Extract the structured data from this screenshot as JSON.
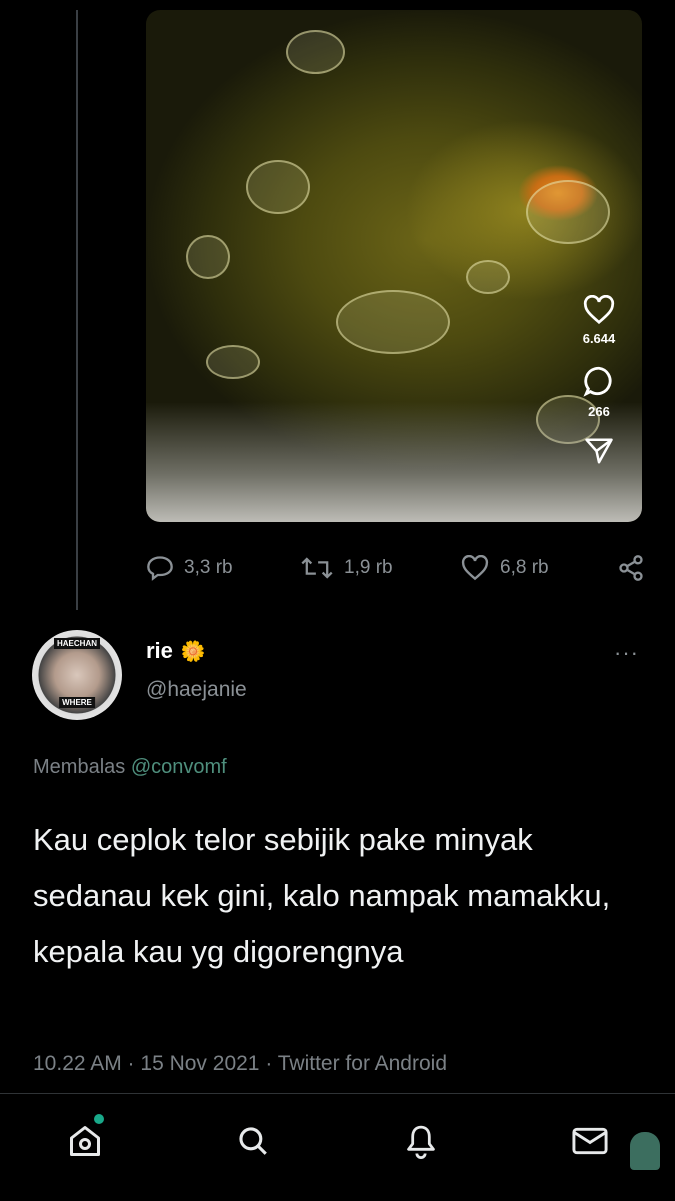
{
  "media": {
    "likes": "6.644",
    "comments": "266",
    "icons": [
      "heart-icon",
      "comment-icon",
      "send-icon"
    ]
  },
  "actions": {
    "replies": "3,3 rb",
    "retweets": "1,9 rb",
    "likes": "6,8 rb",
    "icons": [
      "reply-icon",
      "retweet-icon",
      "like-icon",
      "share-icon"
    ]
  },
  "reply": {
    "avatar_tag_top": "HAECHAN",
    "avatar_tag_bottom": "WHERE",
    "name": "rie",
    "name_emoji": "🌼",
    "handle": "@haejanie",
    "reply_prefix": "Membalas",
    "reply_mention": "@convomf",
    "text": "Kau ceplok telor sebijik pake minyak sedanau kek gini, kalo nampak mamakku, kepala kau yg digorengnya",
    "meta": "10.22 AM · 15 Nov 2021 · Twitter for Android",
    "more": "···"
  },
  "nav": {
    "icons": [
      "home-icon",
      "search-icon",
      "notifications-icon",
      "messages-icon"
    ]
  },
  "colors": {
    "background": "#000000",
    "muted_text": "#8b9196",
    "mention": "#4f8f7d",
    "notification_dot": "#19a98a"
  }
}
